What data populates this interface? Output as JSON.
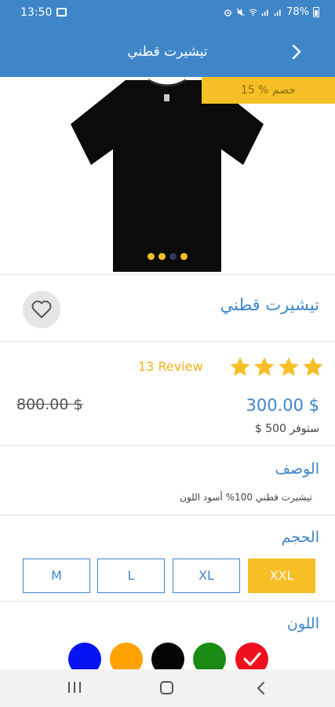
{
  "status_bar": {
    "time": "13:50",
    "battery": "78%"
  },
  "app_bar": {
    "title": "تيشيرت قطني"
  },
  "product_image": {
    "discount_badge": "15 % خصم",
    "carousel_dots": 4,
    "active_dot": 2
  },
  "product": {
    "name": "تيشيرت قطني",
    "rating_stars": 4,
    "review_count": "13 Review",
    "price": "300.00 $",
    "old_price": "800.00 $",
    "savings": "ستوفر 500 $"
  },
  "description": {
    "title": "الوصف",
    "text": "تيشيرت قطني 100% أسود اللون"
  },
  "size": {
    "title": "الحجم",
    "options": [
      "M",
      "L",
      "XL",
      "XXL"
    ],
    "selected": "XXL"
  },
  "color": {
    "title": "اللون",
    "swatches": [
      "#f00f1d",
      "#1a8b14",
      "#050505",
      "#ffa200",
      "#0713f3"
    ],
    "selected_index": 0
  },
  "colors": {
    "primary": "#3f86c9",
    "accent": "#f7bf26"
  },
  "icons": {
    "back": "chevron-right-icon",
    "favorite": "heart-outline-icon",
    "star": "star-icon",
    "check": "check-icon"
  }
}
